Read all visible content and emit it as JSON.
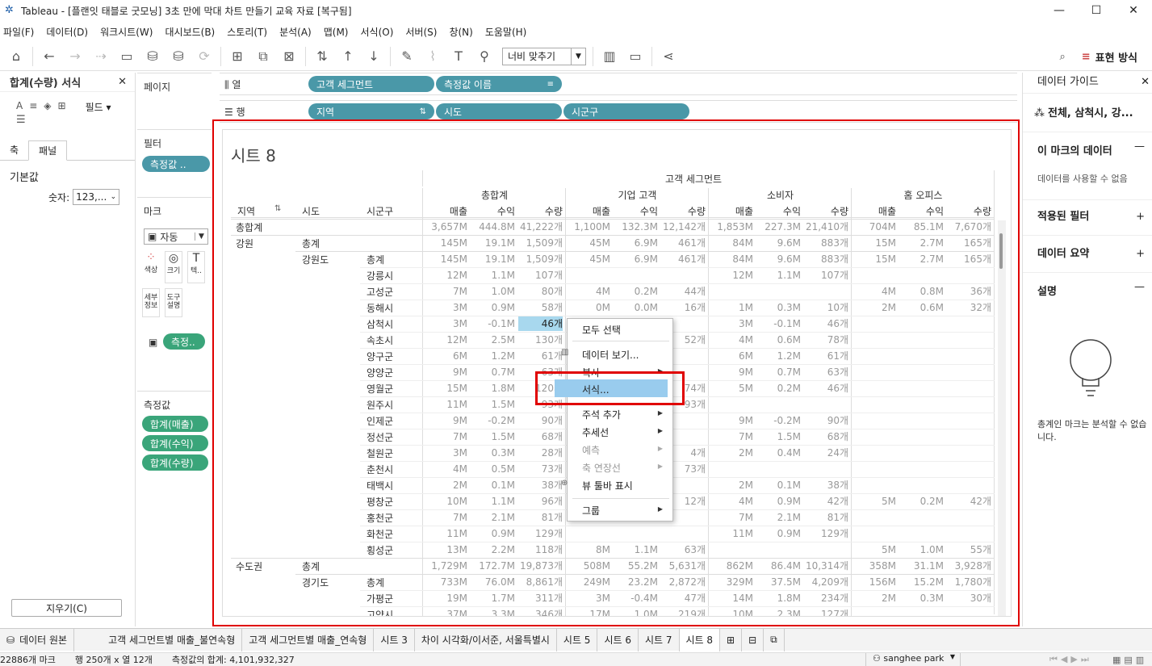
{
  "window": {
    "title": "Tableau - [플랜잇 태블로 굿모닝] 3초 만에 막대 차트 만들기 교육 자료 [복구됨]"
  },
  "menu": [
    "파일(F)",
    "데이터(D)",
    "워크시트(W)",
    "대시보드(B)",
    "스토리(T)",
    "분석(A)",
    "맵(M)",
    "서식(O)",
    "서버(S)",
    "창(N)",
    "도움말(H)"
  ],
  "toolbar": {
    "fit": "너비 맞추기",
    "show_me": "표현 방식"
  },
  "format_pane": {
    "title": "합계(수량) 서식",
    "fields_label": "필드",
    "tab_axis": "축",
    "tab_pane": "패널",
    "default_label": "기본값",
    "number_label": "숫자:",
    "number_value": "123,...",
    "clear_button": "지우기(C)"
  },
  "cards": {
    "pages": "페이지",
    "filters": "필터",
    "filter_pill": "측정값 ..",
    "marks": "마크",
    "mark_type": "자동",
    "mark_buttons": [
      "색상",
      "크기",
      "텍..",
      "세부 정보",
      "도구 설명"
    ],
    "mark_label_pill": "측정..",
    "measure_values": "측정값",
    "measures": [
      "합계(매출)",
      "합계(수익)",
      "합계(수량)"
    ]
  },
  "shelves": {
    "columns_label": "열",
    "rows_label": "행",
    "columns": [
      "고객 세그먼트",
      "측정값 이름"
    ],
    "rows": [
      "지역",
      "시도",
      "시군구"
    ]
  },
  "sheet": {
    "title": "시트 8",
    "top_header": "고객 세그먼트",
    "row_headers": [
      "지역",
      "시도",
      "시군구"
    ],
    "segments": [
      "총합계",
      "기업 고객",
      "소비자",
      "홈 오피스"
    ],
    "measures": [
      "매출",
      "수익",
      "수량"
    ],
    "rows": [
      {
        "r": "총합계",
        "s": "",
        "g": "",
        "v": [
          "3,657M",
          "444.8M",
          "41,222개",
          "1,100M",
          "132.3M",
          "12,142개",
          "1,853M",
          "227.3M",
          "21,410개",
          "704M",
          "85.1M",
          "7,670개"
        ]
      },
      {
        "r": "강원",
        "s": "총계",
        "g": "",
        "v": [
          "145M",
          "19.1M",
          "1,509개",
          "45M",
          "6.9M",
          "461개",
          "84M",
          "9.6M",
          "883개",
          "15M",
          "2.7M",
          "165개"
        ]
      },
      {
        "r": "",
        "s": "강원도",
        "g": "총계",
        "v": [
          "145M",
          "19.1M",
          "1,509개",
          "45M",
          "6.9M",
          "461개",
          "84M",
          "9.6M",
          "883개",
          "15M",
          "2.7M",
          "165개"
        ]
      },
      {
        "r": "",
        "s": "",
        "g": "강릉시",
        "v": [
          "12M",
          "1.1M",
          "107개",
          "",
          "",
          "",
          "12M",
          "1.1M",
          "107개",
          "",
          "",
          ""
        ]
      },
      {
        "r": "",
        "s": "",
        "g": "고성군",
        "v": [
          "7M",
          "1.0M",
          "80개",
          "4M",
          "0.2M",
          "44개",
          "",
          "",
          "",
          "4M",
          "0.8M",
          "36개"
        ]
      },
      {
        "r": "",
        "s": "",
        "g": "동해시",
        "v": [
          "3M",
          "0.9M",
          "58개",
          "0M",
          "0.0M",
          "16개",
          "1M",
          "0.3M",
          "10개",
          "2M",
          "0.6M",
          "32개"
        ]
      },
      {
        "r": "",
        "s": "",
        "g": "삼척시",
        "v": [
          "3M",
          "-0.1M",
          "46개",
          "",
          "",
          "",
          "3M",
          "-0.1M",
          "46개",
          "",
          "",
          ""
        ]
      },
      {
        "r": "",
        "s": "",
        "g": "속초시",
        "v": [
          "12M",
          "2.5M",
          "130개",
          "",
          "",
          "52개",
          "4M",
          "0.6M",
          "78개",
          "",
          "",
          ""
        ]
      },
      {
        "r": "",
        "s": "",
        "g": "양구군",
        "v": [
          "6M",
          "1.2M",
          "61개",
          "",
          "",
          "",
          "6M",
          "1.2M",
          "61개",
          "",
          "",
          ""
        ]
      },
      {
        "r": "",
        "s": "",
        "g": "양양군",
        "v": [
          "9M",
          "0.7M",
          "63개",
          "",
          "",
          "",
          "9M",
          "0.7M",
          "63개",
          "",
          "",
          ""
        ]
      },
      {
        "r": "",
        "s": "",
        "g": "영월군",
        "v": [
          "15M",
          "1.8M",
          "120개",
          "",
          "",
          "74개",
          "5M",
          "0.2M",
          "46개",
          "",
          "",
          ""
        ]
      },
      {
        "r": "",
        "s": "",
        "g": "원주시",
        "v": [
          "11M",
          "1.5M",
          "93개",
          "",
          "",
          "93개",
          "",
          "",
          "",
          "",
          "",
          ""
        ]
      },
      {
        "r": "",
        "s": "",
        "g": "인제군",
        "v": [
          "9M",
          "-0.2M",
          "90개",
          "",
          "",
          "",
          "9M",
          "-0.2M",
          "90개",
          "",
          "",
          ""
        ]
      },
      {
        "r": "",
        "s": "",
        "g": "정선군",
        "v": [
          "7M",
          "1.5M",
          "68개",
          "",
          "",
          "",
          "7M",
          "1.5M",
          "68개",
          "",
          "",
          ""
        ]
      },
      {
        "r": "",
        "s": "",
        "g": "철원군",
        "v": [
          "3M",
          "0.3M",
          "28개",
          "",
          "",
          "4개",
          "2M",
          "0.4M",
          "24개",
          "",
          "",
          ""
        ]
      },
      {
        "r": "",
        "s": "",
        "g": "춘천시",
        "v": [
          "4M",
          "0.5M",
          "73개",
          "",
          "",
          "73개",
          "",
          "",
          "",
          "",
          "",
          ""
        ]
      },
      {
        "r": "",
        "s": "",
        "g": "태백시",
        "v": [
          "2M",
          "0.1M",
          "38개",
          "",
          "",
          "",
          "2M",
          "0.1M",
          "38개",
          "",
          "",
          ""
        ]
      },
      {
        "r": "",
        "s": "",
        "g": "평창군",
        "v": [
          "10M",
          "1.1M",
          "96개",
          "",
          "",
          "12개",
          "4M",
          "0.9M",
          "42개",
          "5M",
          "0.2M",
          "42개"
        ]
      },
      {
        "r": "",
        "s": "",
        "g": "홍천군",
        "v": [
          "7M",
          "2.1M",
          "81개",
          "",
          "",
          "",
          "7M",
          "2.1M",
          "81개",
          "",
          "",
          ""
        ]
      },
      {
        "r": "",
        "s": "",
        "g": "화천군",
        "v": [
          "11M",
          "0.9M",
          "129개",
          "",
          "",
          "",
          "11M",
          "0.9M",
          "129개",
          "",
          "",
          ""
        ]
      },
      {
        "r": "",
        "s": "",
        "g": "횡성군",
        "v": [
          "13M",
          "2.2M",
          "118개",
          "8M",
          "1.1M",
          "63개",
          "",
          "",
          "",
          "5M",
          "1.0M",
          "55개"
        ]
      },
      {
        "r": "수도권",
        "s": "총계",
        "g": "",
        "v": [
          "1,729M",
          "172.7M",
          "19,873개",
          "508M",
          "55.2M",
          "5,631개",
          "862M",
          "86.4M",
          "10,314개",
          "358M",
          "31.1M",
          "3,928개"
        ]
      },
      {
        "r": "",
        "s": "경기도",
        "g": "총계",
        "v": [
          "733M",
          "76.0M",
          "8,861개",
          "249M",
          "23.2M",
          "2,872개",
          "329M",
          "37.5M",
          "4,209개",
          "156M",
          "15.2M",
          "1,780개"
        ]
      },
      {
        "r": "",
        "s": "",
        "g": "가평군",
        "v": [
          "19M",
          "1.7M",
          "311개",
          "3M",
          "-0.4M",
          "47개",
          "14M",
          "1.8M",
          "234개",
          "2M",
          "0.3M",
          "30개"
        ]
      },
      {
        "r": "",
        "s": "",
        "g": "고양시",
        "v": [
          "37M",
          "3.3M",
          "346개",
          "17M",
          "1.0M",
          "219개",
          "10M",
          "2.3M",
          "127개",
          "",
          "",
          ""
        ]
      }
    ]
  },
  "context_menu": {
    "items": [
      "모두 선택",
      "데이터 보기...",
      "복사",
      "서식...",
      "주석 추가",
      "추세선",
      "예측",
      "축 연장선",
      "뷰 툴바 표시",
      "그룹"
    ]
  },
  "data_guide": {
    "title": "데이터 가이드",
    "crumb": "전체, 삼척시, 강...",
    "mark_data": "이 마크의 데이터",
    "mark_data_text": "데이터를 사용할 수 없음",
    "applied_filters": "적용된 필터",
    "data_summary": "데이터 요약",
    "description": "설명",
    "description_text": "총계인 마크는 분석할 수 없습니다."
  },
  "sheet_tabs": [
    "데이터 원본",
    "고객 세그먼트별 매출_불연속형",
    "고객 세그먼트별 매출_연속형",
    "시트 3",
    "차이 시각화/이서준, 서울특별시",
    "시트 5",
    "시트 6",
    "시트 7",
    "시트 8"
  ],
  "status": {
    "marks": "22886개 마크",
    "rows_cols": "행 250개  x  열 12개",
    "sum": "측정값의 합계: 4,101,932,327",
    "user": "sanghee park"
  },
  "colors": {
    "pill_blue": "#4a98a8",
    "pill_green": "#3aa57a",
    "highlight_red": "#e00000",
    "menu_highlight": "#99ccee",
    "selected_cell": "#a8d8ee"
  }
}
